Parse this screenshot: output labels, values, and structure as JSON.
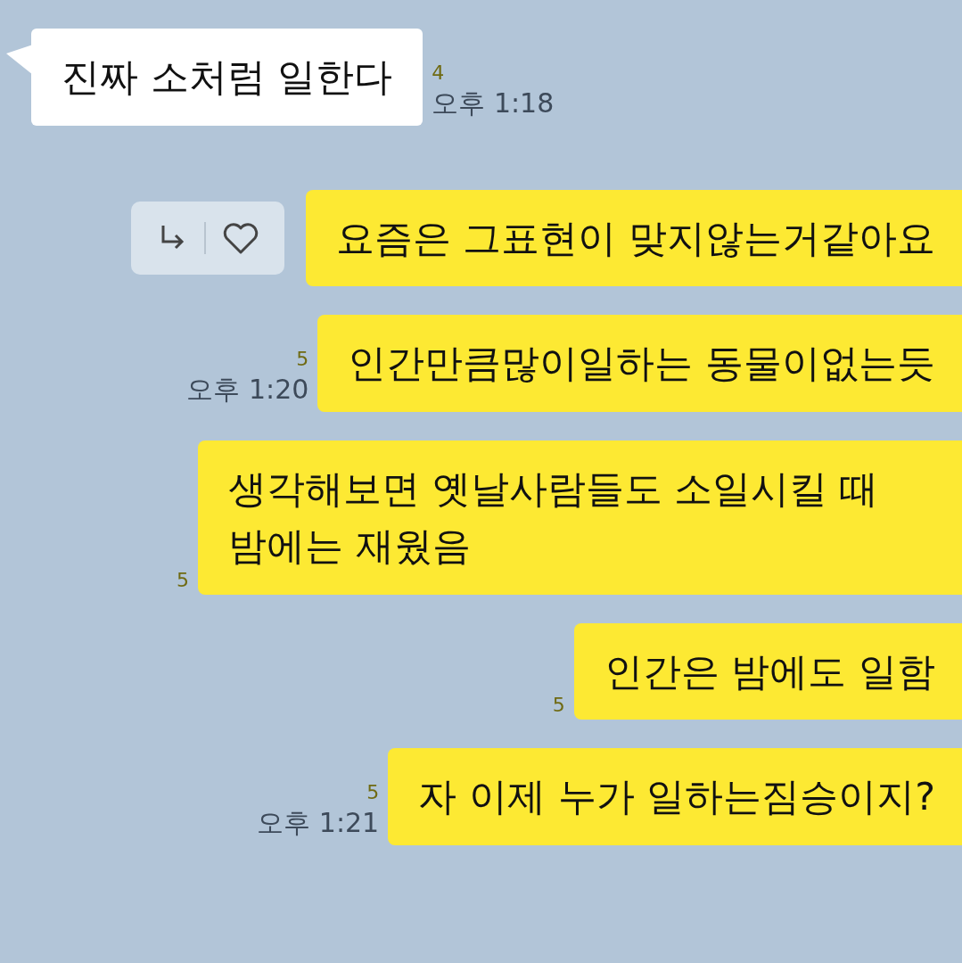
{
  "messages": [
    {
      "kind": "received",
      "text": "진짜 소처럼 일한다",
      "unread": "4",
      "time": "오후 1:18",
      "actions": false
    },
    {
      "kind": "sent",
      "text": "요즘은 그표현이 맞지않는거같아요",
      "actions": true
    },
    {
      "kind": "sent",
      "text": "인간만큼많이일하는 동물이없는듯",
      "unread": "5",
      "time": "오후 1:20",
      "actions": false
    },
    {
      "kind": "sent",
      "text": "생각해보면 옛날사람들도 소일시킬 때 밤에는 재웠음",
      "unread": "5",
      "actions": false
    },
    {
      "kind": "sent",
      "text": "인간은 밤에도 일함",
      "unread": "5",
      "actions": false
    },
    {
      "kind": "sent",
      "text": "자 이제 누가 일하는짐승이지?",
      "unread": "5",
      "time": "오후 1:21",
      "actions": false
    }
  ]
}
